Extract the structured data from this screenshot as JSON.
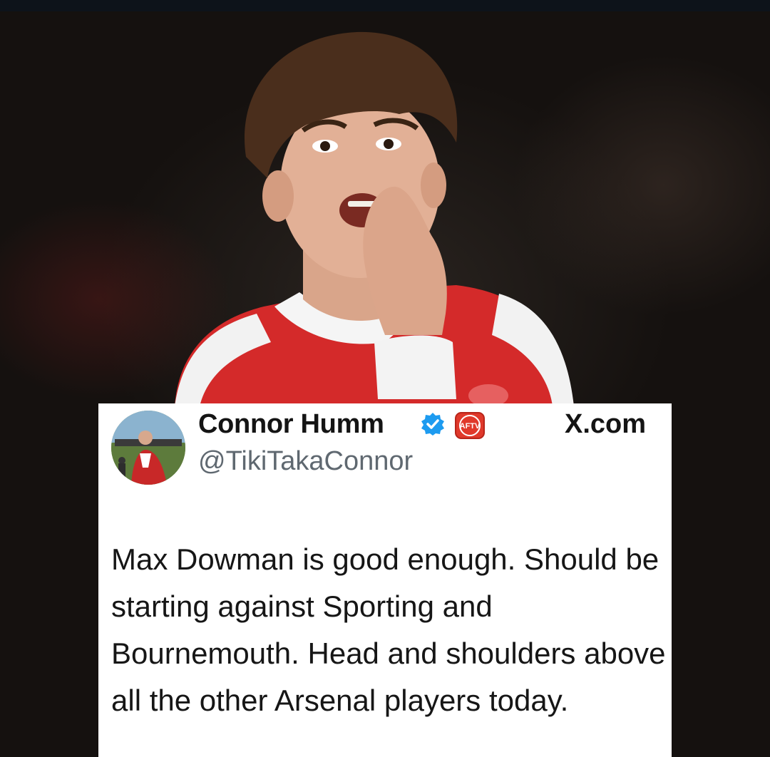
{
  "tweet": {
    "display_name": "Connor Humm",
    "handle": "@TikiTakaConnor",
    "site": "X.com",
    "badge_text": "AFTV",
    "text": "Max Dowman is good enough. Should be starting against Sporting and Bournemouth. Head and shoulders above all the other Arsenal players today."
  },
  "icons": {
    "verified": "verified-badge-icon",
    "affiliate": "aftv-logo-icon"
  },
  "colors": {
    "verified_blue": "#1d9bf0",
    "aftv_red": "#e0392b",
    "kit_red": "#d42a2a",
    "card_bg": "#ffffff",
    "handle_gray": "#5f6870"
  }
}
